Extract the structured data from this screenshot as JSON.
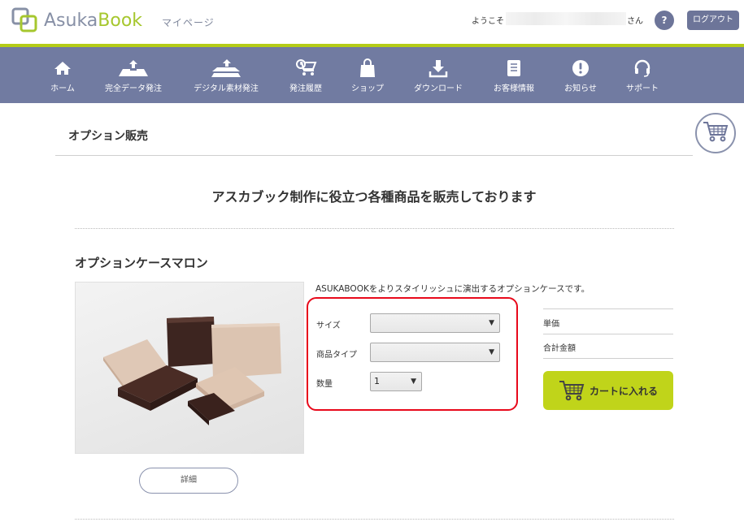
{
  "header": {
    "logo_text_a": "Asuka",
    "logo_text_b": "Book",
    "mypage": "マイページ",
    "welcome_prefix": "ようこそ",
    "welcome_suffix": "さん",
    "help_label": "?",
    "logout_label": "ログアウト"
  },
  "nav": {
    "items": [
      {
        "label": "ホーム",
        "icon": "home-icon"
      },
      {
        "label": "完全データ発注",
        "icon": "upload-tray-icon"
      },
      {
        "label": "デジタル素材発注",
        "icon": "upload-layers-icon"
      },
      {
        "label": "発注履歴",
        "icon": "cart-history-icon"
      },
      {
        "label": "ショップ",
        "icon": "shopping-bag-icon"
      },
      {
        "label": "ダウンロード",
        "icon": "download-icon"
      },
      {
        "label": "お客様情報",
        "icon": "document-icon"
      },
      {
        "label": "お知らせ",
        "icon": "alert-icon"
      },
      {
        "label": "サポート",
        "icon": "headset-icon"
      }
    ]
  },
  "page": {
    "title": "オプション販売",
    "headline": "アスカブック制作に役立つ各種商品を販売しております"
  },
  "product": {
    "name": "オプションケースマロン",
    "description": "ASUKABOOKをよりスタイリッシュに演出するオプションケースです。",
    "detail_button": "詳細",
    "form": {
      "size_label": "サイズ",
      "size_value": "",
      "type_label": "商品タイプ",
      "type_value": "",
      "qty_label": "数量",
      "qty_value": "1"
    },
    "unit_price_label": "単価",
    "total_label": "合計金額",
    "cart_button": "カートに入れる"
  },
  "colors": {
    "nav_bg": "#717ba1",
    "accent_green": "#b4cc17",
    "cart_button": "#c0d41a",
    "highlight_border": "#e8091b"
  }
}
